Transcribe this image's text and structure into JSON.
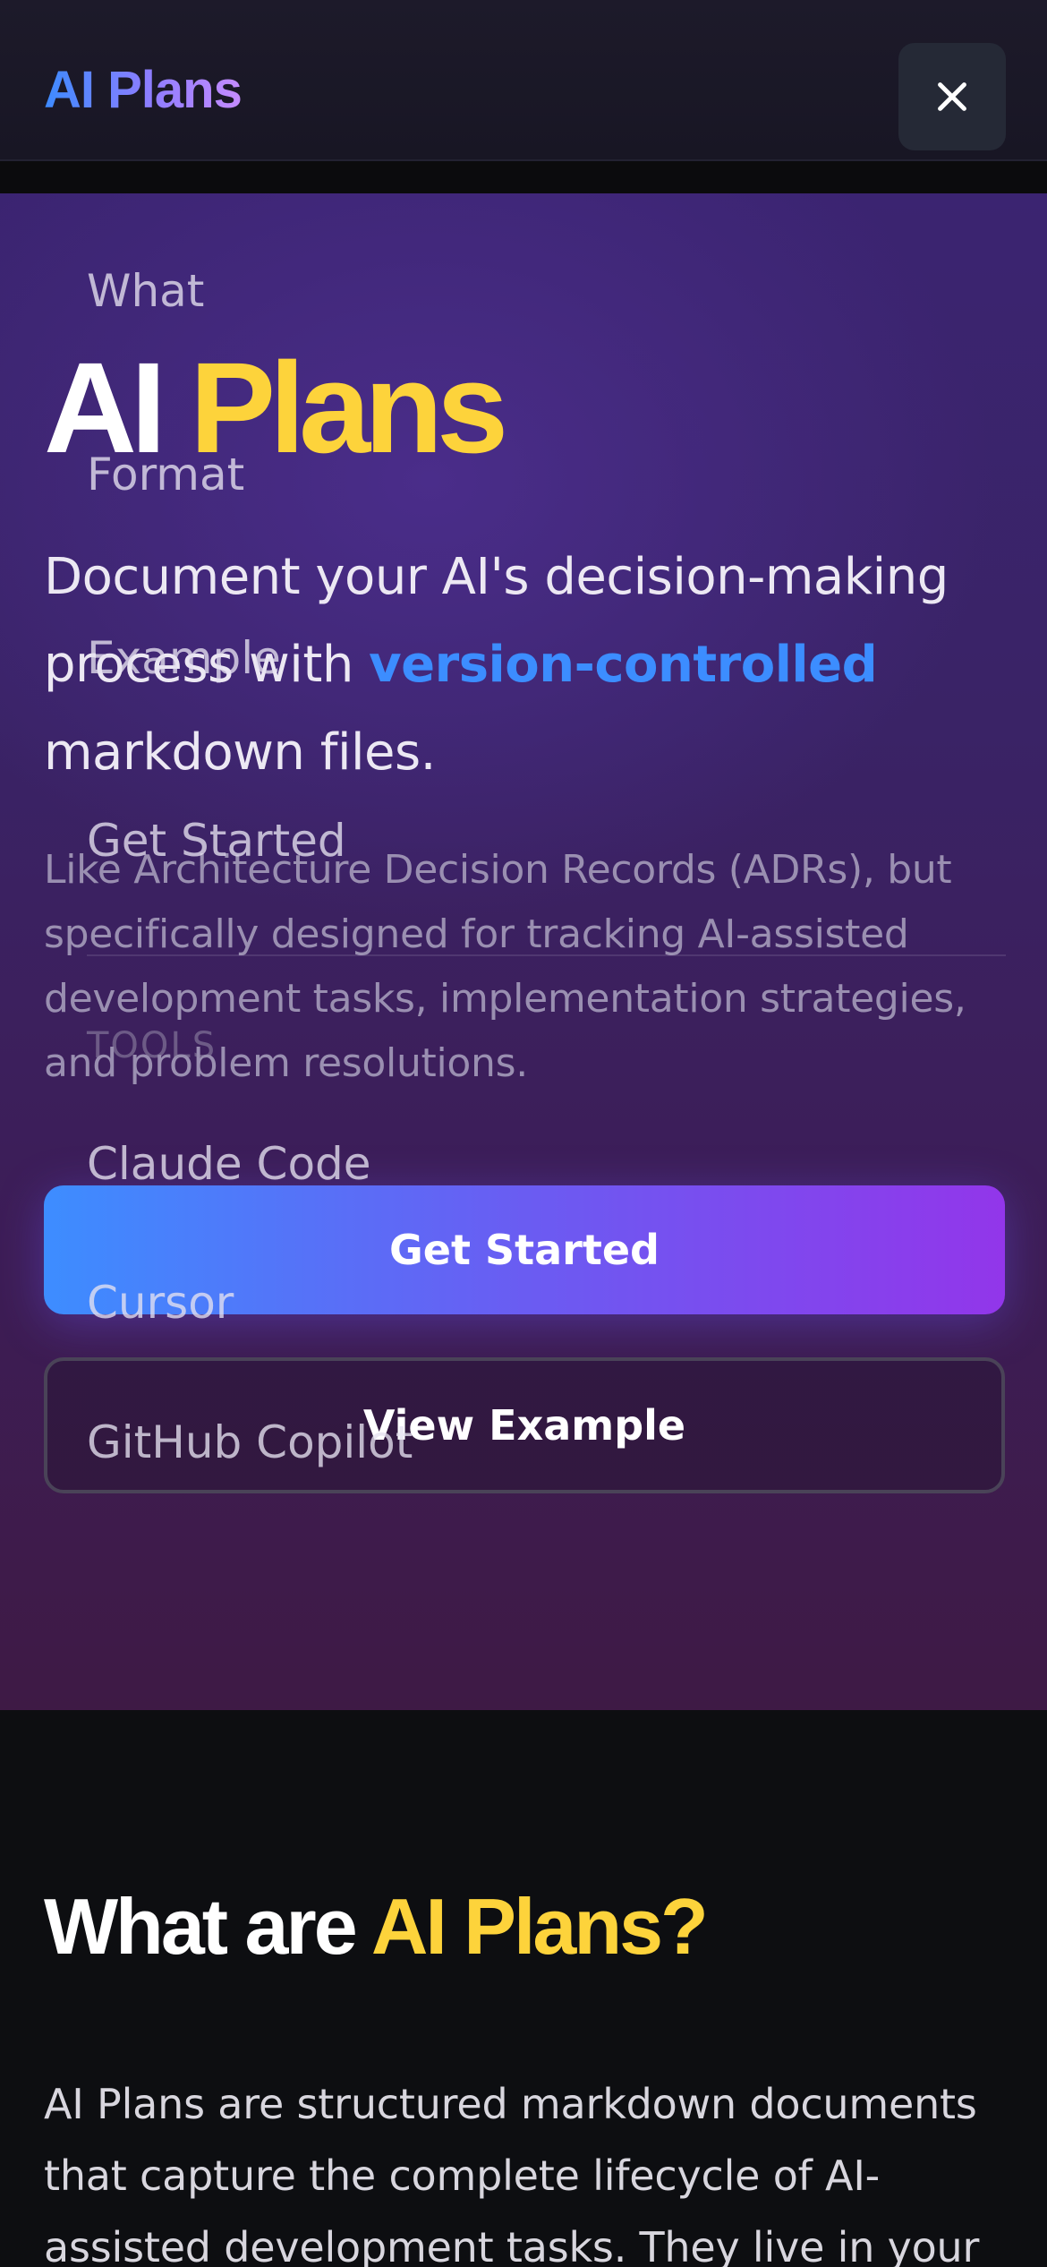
{
  "header": {
    "logo": "AI Plans",
    "close_icon": "close-icon"
  },
  "hero": {
    "title_white": "AI",
    "title_yellow": "Plans",
    "description_before": "Document your AI's decision-making process with ",
    "description_highlight": "version-controlled",
    "description_after": " markdown files.",
    "subtext": "Like Architecture Decision Records (ADRs), but specifically designed for tracking AI-assisted development tasks, implementation strategies, and problem resolutions.",
    "primary_button": "Get Started",
    "secondary_button": "View Example"
  },
  "menu": {
    "items": [
      "What",
      "Format",
      "Example",
      "Get Started"
    ],
    "tools_heading": "TOOLS",
    "tools": [
      "Claude Code",
      "Cursor",
      "GitHub Copilot"
    ]
  },
  "what_section": {
    "title_white": "What are",
    "title_yellow": "AI Plans?",
    "body": "AI Plans are structured markdown documents that capture the complete lifecycle of AI-assisted development tasks. They live in your"
  },
  "colors": {
    "accent_yellow": "#fdd33b",
    "accent_blue": "#3c8dff",
    "accent_purple": "#9236ea",
    "page_background": "#0d0e11"
  }
}
